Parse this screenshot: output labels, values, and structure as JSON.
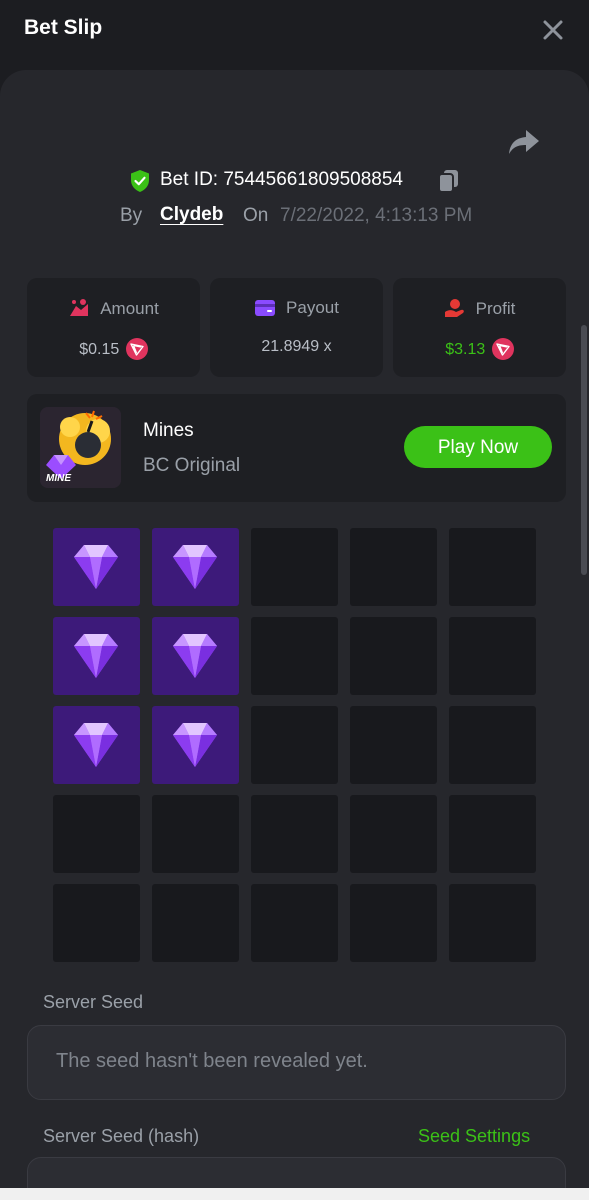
{
  "header": {
    "title": "Bet Slip"
  },
  "bet": {
    "id_text": "Bet ID: 75445661809508854",
    "by_label": "By",
    "user": "Clydeb",
    "on_label": "On",
    "date": "7/22/2022, 4:13:13 PM"
  },
  "stats": {
    "amount": {
      "label": "Amount",
      "value": "$0.15"
    },
    "payout": {
      "label": "Payout",
      "value": "21.8949 x"
    },
    "profit": {
      "label": "Profit",
      "value": "$3.13"
    }
  },
  "game": {
    "name": "Mines",
    "subtitle": "BC Original",
    "thumb_text": "MINE",
    "play_label": "Play Now"
  },
  "board": {
    "rows": 5,
    "cols": 5,
    "gems": [
      [
        0,
        0
      ],
      [
        0,
        1
      ],
      [
        1,
        0
      ],
      [
        1,
        1
      ],
      [
        2,
        0
      ],
      [
        2,
        1
      ]
    ]
  },
  "seeds": {
    "server_seed_label": "Server Seed",
    "server_seed_value": "The seed hasn't been revealed yet.",
    "server_hash_label": "Server Seed (hash)",
    "settings_link": "Seed Settings"
  },
  "colors": {
    "accent_green": "#3bc117",
    "gem_cell": "#3d1a7a",
    "coin": "#e0345e"
  }
}
